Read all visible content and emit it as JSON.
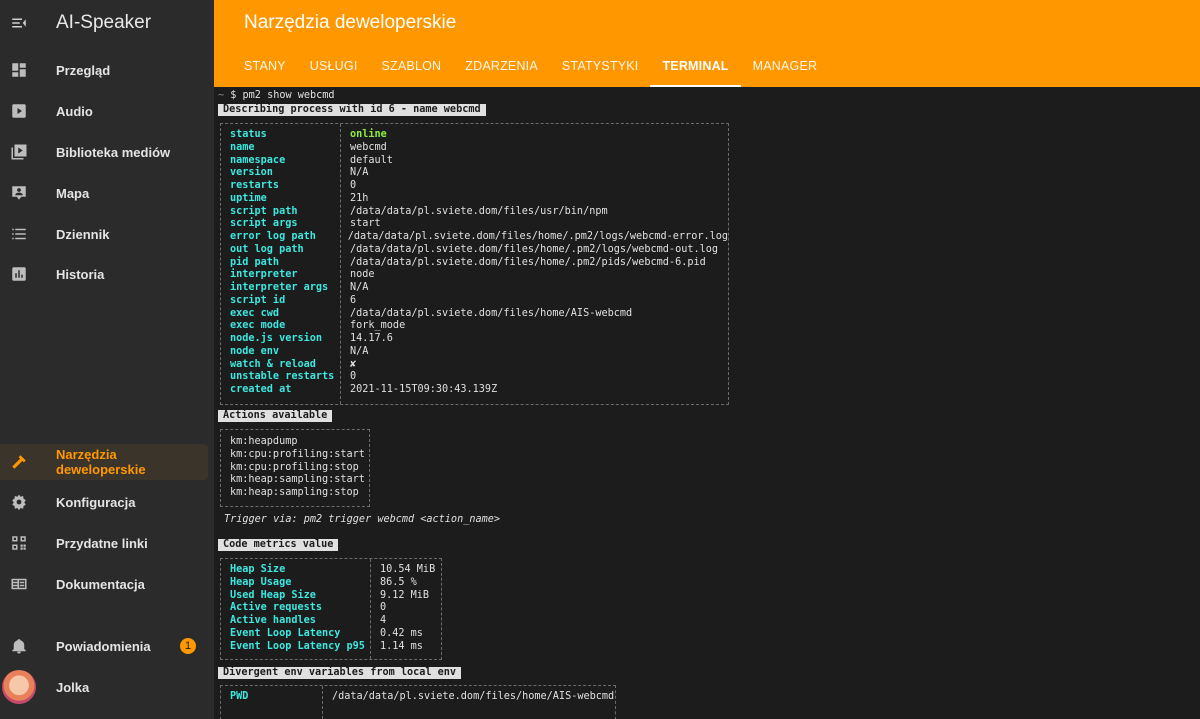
{
  "sidebar": {
    "app_title": "AI-Speaker",
    "items": [
      {
        "label": "Przegląd",
        "icon": "dashboard-icon"
      },
      {
        "label": "Audio",
        "icon": "play-icon"
      },
      {
        "label": "Biblioteka mediów",
        "icon": "media-library-icon"
      },
      {
        "label": "Mapa",
        "icon": "map-icon"
      },
      {
        "label": "Dziennik",
        "icon": "list-icon"
      },
      {
        "label": "Historia",
        "icon": "chart-icon"
      }
    ],
    "bottom_items": [
      {
        "label": "Narzędzia deweloperskie",
        "icon": "hammer-icon",
        "active": true
      },
      {
        "label": "Konfiguracja",
        "icon": "gear-icon"
      },
      {
        "label": "Przydatne linki",
        "icon": "qr-code-icon"
      },
      {
        "label": "Dokumentacja",
        "icon": "book-icon"
      }
    ],
    "notifications": {
      "label": "Powiadomienia",
      "icon": "bell-icon",
      "count": "1"
    },
    "user": {
      "label": "Jolka"
    }
  },
  "header": {
    "title": "Narzędzia deweloperskie",
    "tabs": [
      "STANY",
      "USŁUGI",
      "SZABLON",
      "ZDARZENIA",
      "STATYSTYKI",
      "TERMINAL",
      "MANAGER"
    ],
    "active_tab": "TERMINAL"
  },
  "colors": {
    "accent": "#ff9800",
    "key": "#3ce8e0",
    "online": "#90ee3a"
  },
  "terminal": {
    "prompt_tilde": "~",
    "prompt_command": " $ pm2 show webcmd",
    "describing_title": "Describing process with id 6 - name webcmd",
    "process": [
      {
        "k": "status",
        "v": "online"
      },
      {
        "k": "name",
        "v": "webcmd"
      },
      {
        "k": "namespace",
        "v": "default"
      },
      {
        "k": "version",
        "v": "N/A"
      },
      {
        "k": "restarts",
        "v": "0"
      },
      {
        "k": "uptime",
        "v": "21h"
      },
      {
        "k": "script path",
        "v": "/data/data/pl.sviete.dom/files/usr/bin/npm"
      },
      {
        "k": "script args",
        "v": "start"
      },
      {
        "k": "error log path",
        "v": "/data/data/pl.sviete.dom/files/home/.pm2/logs/webcmd-error.log"
      },
      {
        "k": "out log path",
        "v": "/data/data/pl.sviete.dom/files/home/.pm2/logs/webcmd-out.log"
      },
      {
        "k": "pid path",
        "v": "/data/data/pl.sviete.dom/files/home/.pm2/pids/webcmd-6.pid"
      },
      {
        "k": "interpreter",
        "v": "node"
      },
      {
        "k": "interpreter args",
        "v": "N/A"
      },
      {
        "k": "script id",
        "v": "6"
      },
      {
        "k": "exec cwd",
        "v": "/data/data/pl.sviete.dom/files/home/AIS-webcmd"
      },
      {
        "k": "exec mode",
        "v": "fork_mode"
      },
      {
        "k": "node.js version",
        "v": "14.17.6"
      },
      {
        "k": "node env",
        "v": "N/A"
      },
      {
        "k": "watch & reload",
        "v": "✘"
      },
      {
        "k": "unstable restarts",
        "v": "0"
      },
      {
        "k": "created at",
        "v": "2021-11-15T09:30:43.139Z"
      }
    ],
    "actions_title": "Actions available",
    "actions": [
      "km:heapdump",
      "km:cpu:profiling:start",
      "km:cpu:profiling:stop",
      "km:heap:sampling:start",
      "km:heap:sampling:stop"
    ],
    "trigger_text": "Trigger via: pm2 trigger webcmd <action_name>",
    "metrics_title": "Code metrics value",
    "metrics": [
      {
        "k": "Heap Size",
        "v": "10.54 MiB"
      },
      {
        "k": "Heap Usage",
        "v": "86.5 %"
      },
      {
        "k": "Used Heap Size",
        "v": "9.12 MiB"
      },
      {
        "k": "Active requests",
        "v": "0"
      },
      {
        "k": "Active handles",
        "v": "4"
      },
      {
        "k": "Event Loop Latency",
        "v": "0.42 ms"
      },
      {
        "k": "Event Loop Latency p95",
        "v": "1.14 ms"
      }
    ],
    "env_title": "Divergent env variables from local env",
    "env": [
      {
        "k": "PWD",
        "v": "/data/data/pl.sviete.dom/files/home/AIS-webcmd"
      }
    ]
  }
}
